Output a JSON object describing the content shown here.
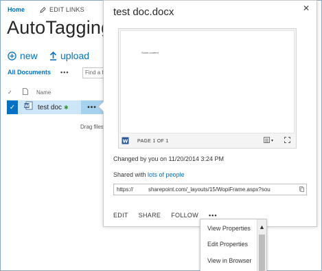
{
  "topnav": {
    "home": "Home",
    "edit_links": "EDIT LINKS"
  },
  "library": {
    "title": "AutoTagging",
    "commands": {
      "new": "new",
      "upload": "upload"
    },
    "view": "All Documents",
    "view_more": "•••",
    "find_placeholder": "Find a f",
    "column_name": "Name",
    "row": {
      "filename": "test doc",
      "new_marker": "✱",
      "more": "•••"
    },
    "drag_text": "Drag files"
  },
  "callout": {
    "title": "test doc.docx",
    "close": "✕",
    "preview": {
      "page_text": "Some content",
      "page_indicator": "PAGE 1 OF 1"
    },
    "changed": "Changed by you on 11/20/2014 3:24 PM",
    "shared_prefix": "Shared with ",
    "shared_link": "lots of people",
    "url_start": "https://",
    "url_end": "sharepoint.com/_layouts/15/WopiFrame.aspx?sou",
    "actions": {
      "edit": "EDIT",
      "share": "SHARE",
      "follow": "FOLLOW",
      "more": "•••"
    }
  },
  "menu": {
    "items": [
      "View Properties",
      "Edit Properties",
      "View in Browser"
    ]
  },
  "colors": {
    "accent": "#0072c6",
    "selected_row": "#cde6f7",
    "ellipsis_bg": "#a6d1ef"
  }
}
